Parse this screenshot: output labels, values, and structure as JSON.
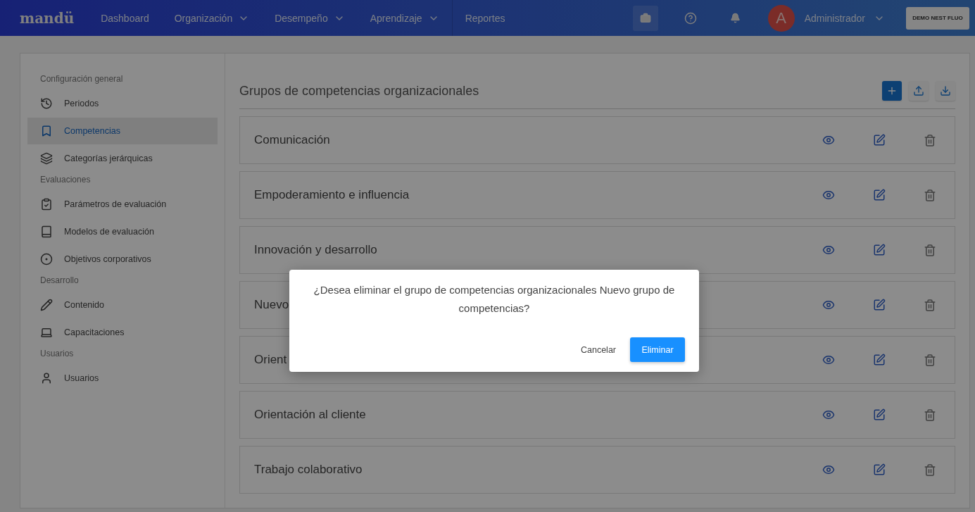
{
  "header": {
    "logo": "mandü",
    "nav": [
      {
        "label": "Dashboard",
        "dropdown": false
      },
      {
        "label": "Organización",
        "dropdown": true
      },
      {
        "label": "Desempeño",
        "dropdown": true
      },
      {
        "label": "Aprendizaje",
        "dropdown": true
      },
      {
        "label": "Reportes",
        "dropdown": false
      }
    ],
    "user": {
      "initial": "A",
      "name": "Administrador"
    },
    "company_button": "DEMO NEST FLUO"
  },
  "sidebar": [
    {
      "title": "Configuración general",
      "items": [
        {
          "label": "Periodos",
          "selected": false
        },
        {
          "label": "Competencias",
          "selected": true
        },
        {
          "label": "Categorías jerárquicas",
          "selected": false
        }
      ]
    },
    {
      "title": "Evaluaciones",
      "items": [
        {
          "label": "Parámetros de evaluación",
          "selected": false
        },
        {
          "label": "Modelos de evaluación",
          "selected": false
        },
        {
          "label": "Objetivos corporativos",
          "selected": false
        }
      ]
    },
    {
      "title": "Desarrollo",
      "items": [
        {
          "label": "Contenido",
          "selected": false
        },
        {
          "label": "Capacitaciones",
          "selected": false
        }
      ]
    },
    {
      "title": "Usuarios",
      "items": [
        {
          "label": "Usuarios",
          "selected": false
        }
      ]
    }
  ],
  "content": {
    "title": "Grupos de competencias organizacionales",
    "rows": [
      {
        "name": "Comunicación"
      },
      {
        "name": "Empoderamiento e influencia"
      },
      {
        "name": "Innovación y desarrollo"
      },
      {
        "name": "Nuevo"
      },
      {
        "name": "Orient"
      },
      {
        "name": "Orientación al cliente"
      },
      {
        "name": "Trabajo colaborativo"
      }
    ]
  },
  "dialog": {
    "message": "¿Desea eliminar el grupo de competencias organizacionales Nuevo grupo de competencias?",
    "cancel": "Cancelar",
    "confirm": "Eliminar"
  }
}
